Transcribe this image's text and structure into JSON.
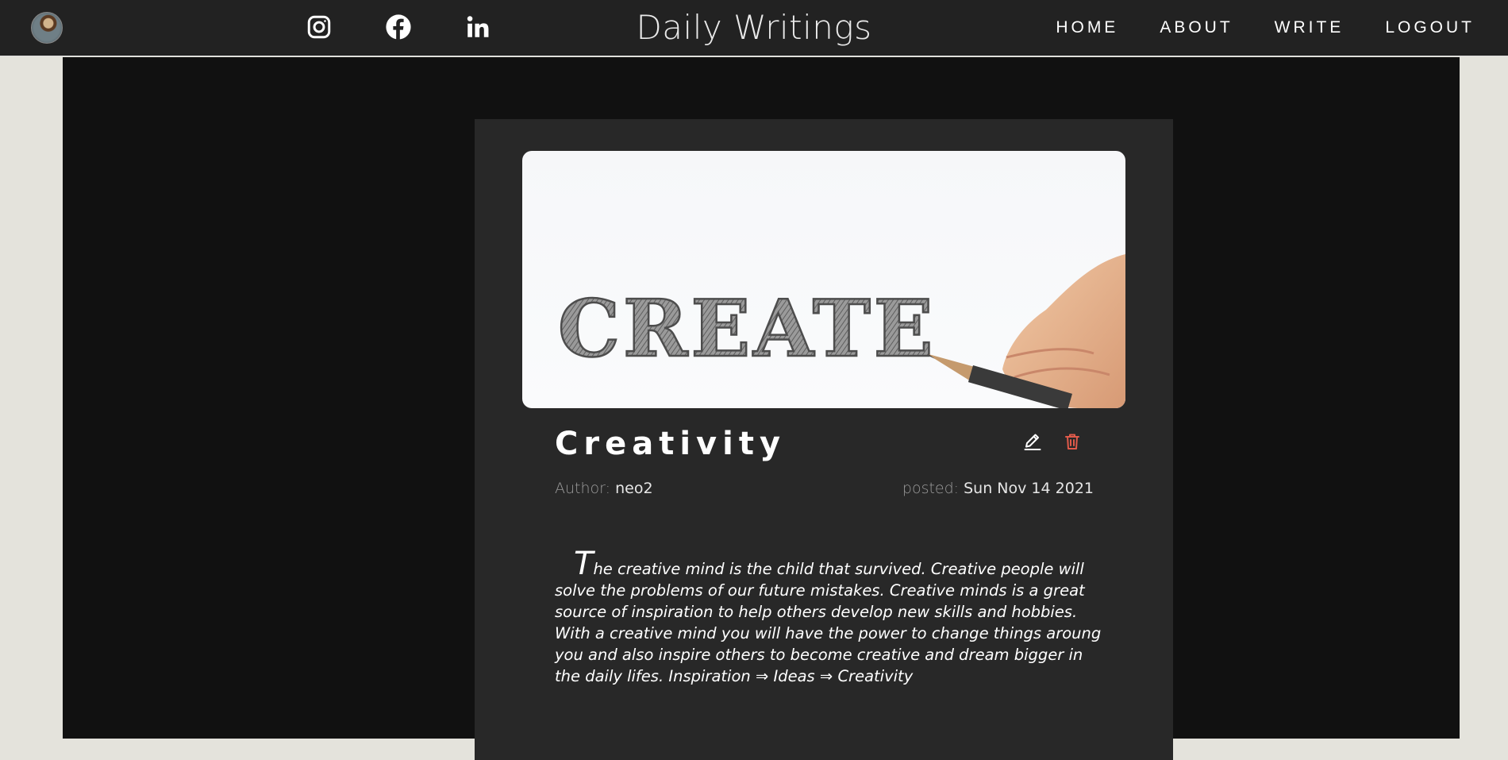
{
  "header": {
    "brand": "Daily Writings",
    "nav": [
      "HOME",
      "ABOUT",
      "WRITE",
      "LOGOUT"
    ],
    "social_icons": [
      "instagram-icon",
      "facebook-icon",
      "linkedin-icon"
    ]
  },
  "post": {
    "image_text": "CREATE",
    "title": "Creativity",
    "author_label": "Author:",
    "author": "neo2",
    "posted_label": "posted:",
    "date": "Sun Nov 14 2021",
    "body": "The creative mind is the child that survived. Creative people will solve the problems of our future mistakes. Creative minds is a great source of inspiration to help others develop new skills and hobbies. With a creative mind you will have the power to change things aroung you and also inspire others to become creative and dream bigger in the daily lifes. Inspiration ⇒ Ideas ⇒ Creativity",
    "actions": [
      "edit-icon",
      "trash-icon"
    ]
  },
  "colors": {
    "topbar": "#222222",
    "page_bg": "#111111",
    "card_bg": "#282828",
    "outer_bg": "#e4e3dc",
    "delete_accent": "#e05a4a"
  }
}
